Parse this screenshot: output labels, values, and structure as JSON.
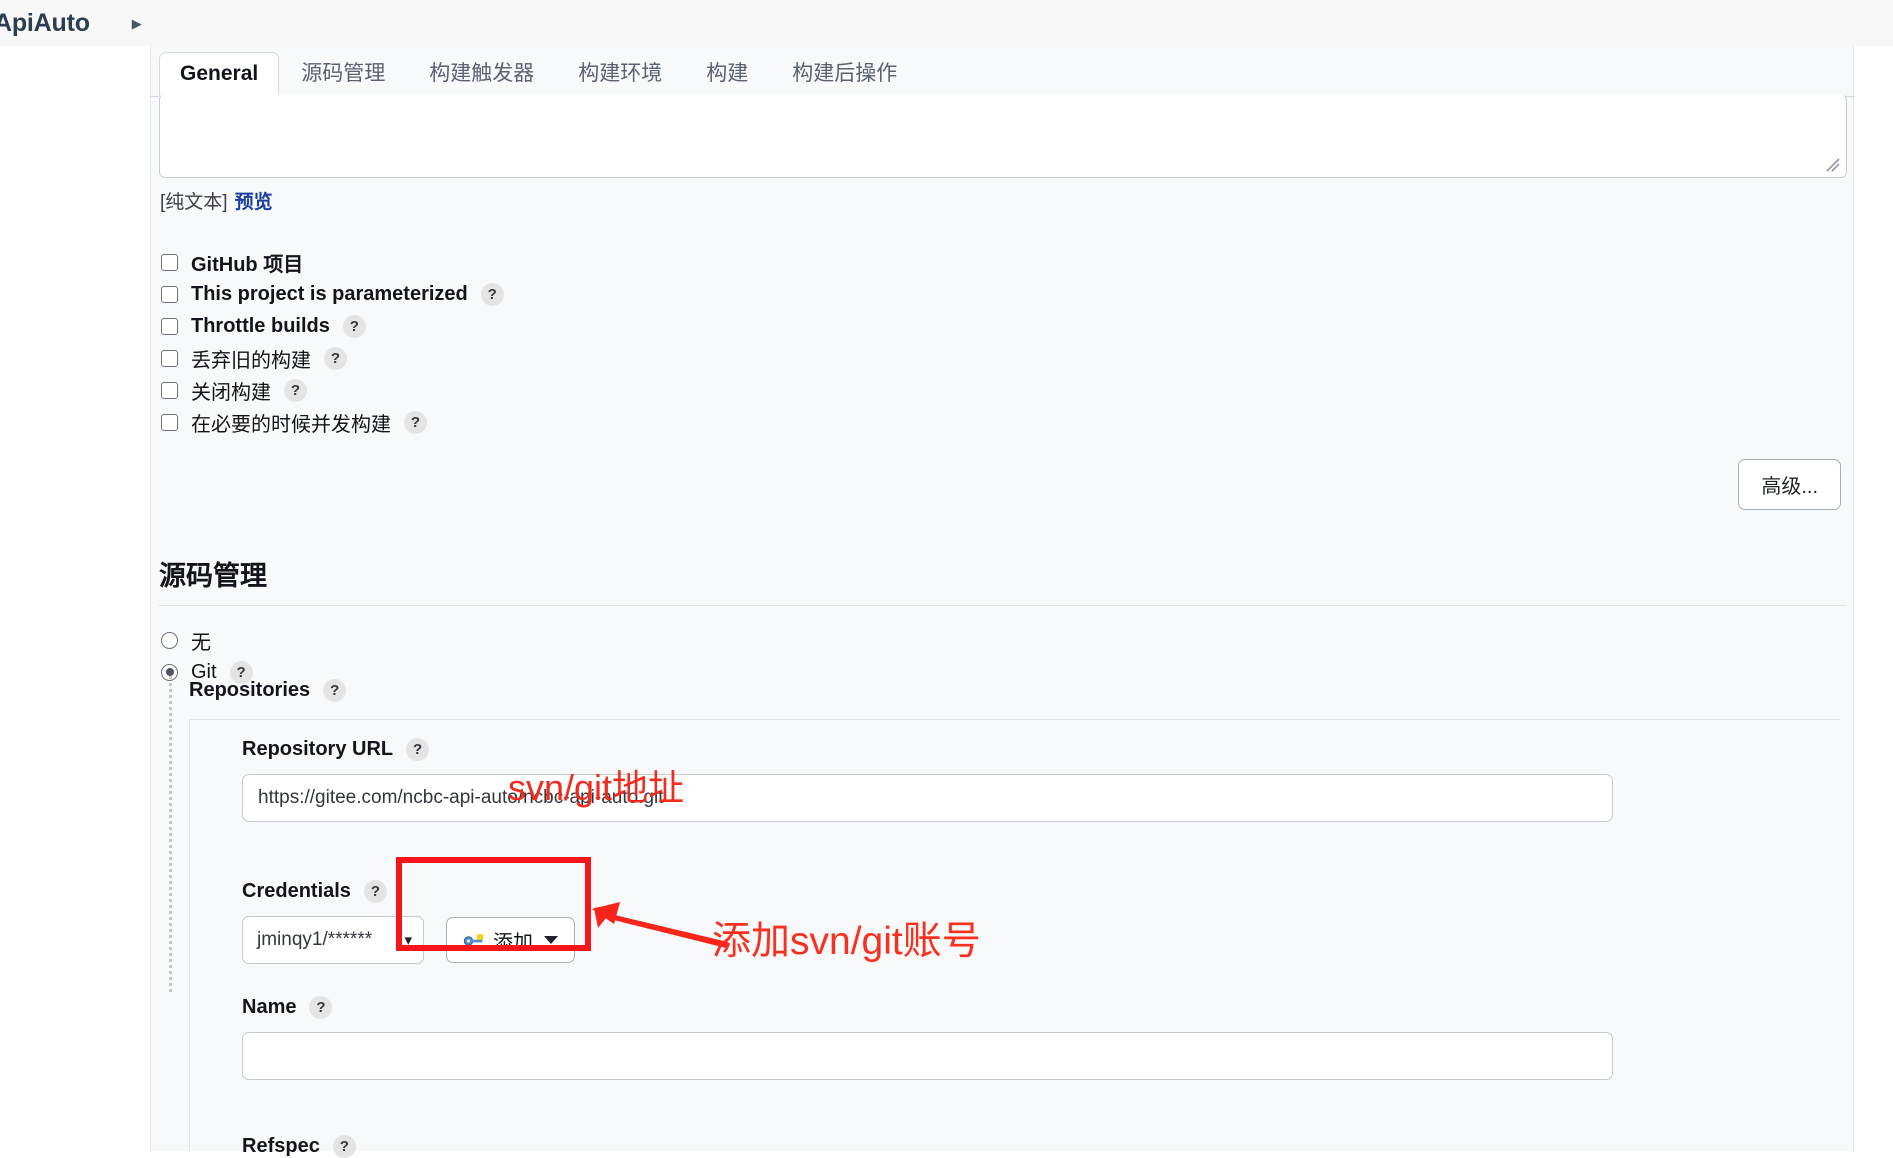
{
  "breadcrumb": {
    "title": "ApiAuto",
    "caret_icon": "caret-right-icon"
  },
  "tabs": [
    {
      "label": "General",
      "active": true
    },
    {
      "label": "源码管理",
      "active": false
    },
    {
      "label": "构建触发器",
      "active": false
    },
    {
      "label": "构建环境",
      "active": false
    },
    {
      "label": "构建",
      "active": false
    },
    {
      "label": "构建后操作",
      "active": false
    }
  ],
  "description": {
    "value": "",
    "markup_note": "[纯文本]",
    "preview_label": "预览",
    "resize_icon": "resize-grip-icon"
  },
  "checkboxes": [
    {
      "label": "GitHub 项目",
      "bold": true,
      "checked": false,
      "help": false
    },
    {
      "label": "This project is parameterized",
      "bold": true,
      "checked": false,
      "help": true
    },
    {
      "label": "Throttle builds",
      "bold": true,
      "checked": false,
      "help": true
    },
    {
      "label": "丢弃旧的构建",
      "bold": false,
      "checked": false,
      "help": true
    },
    {
      "label": "关闭构建",
      "bold": false,
      "checked": false,
      "help": true
    },
    {
      "label": "在必要的时候并发构建",
      "bold": false,
      "checked": false,
      "help": true
    }
  ],
  "advanced_button": {
    "label": "高级..."
  },
  "scm": {
    "title": "源码管理",
    "radios": [
      {
        "label": "无",
        "selected": false,
        "help": false
      },
      {
        "label": "Git",
        "selected": true,
        "help": true
      }
    ],
    "repositories_label": "Repositories",
    "fields": {
      "url_label": "Repository URL",
      "url_value": "https://gitee.com/ncbc-api-auto/ncbc-api-auto.git",
      "credentials_label": "Credentials",
      "credentials_value": "jminqy1/******",
      "credentials_chevron": "chevron-down-icon",
      "add_button_label": "添加",
      "add_button_icon": "key-icon",
      "add_button_caret": "caret-down-icon",
      "name_label": "Name",
      "name_value": "",
      "refspec_label": "Refspec"
    },
    "help_glyph": "?"
  },
  "annotations": {
    "url_note": "svn/git地址",
    "credentials_note": "添加svn/git账号",
    "arrow_icon": "left-arrow-icon",
    "highlight_icon": "red-rectangle-highlight"
  },
  "colors": {
    "annotation_red": "#f8261a",
    "link_blue": "#1b3fa0",
    "page_bg": "#f8f9fa",
    "border": "#dfe2e6"
  }
}
